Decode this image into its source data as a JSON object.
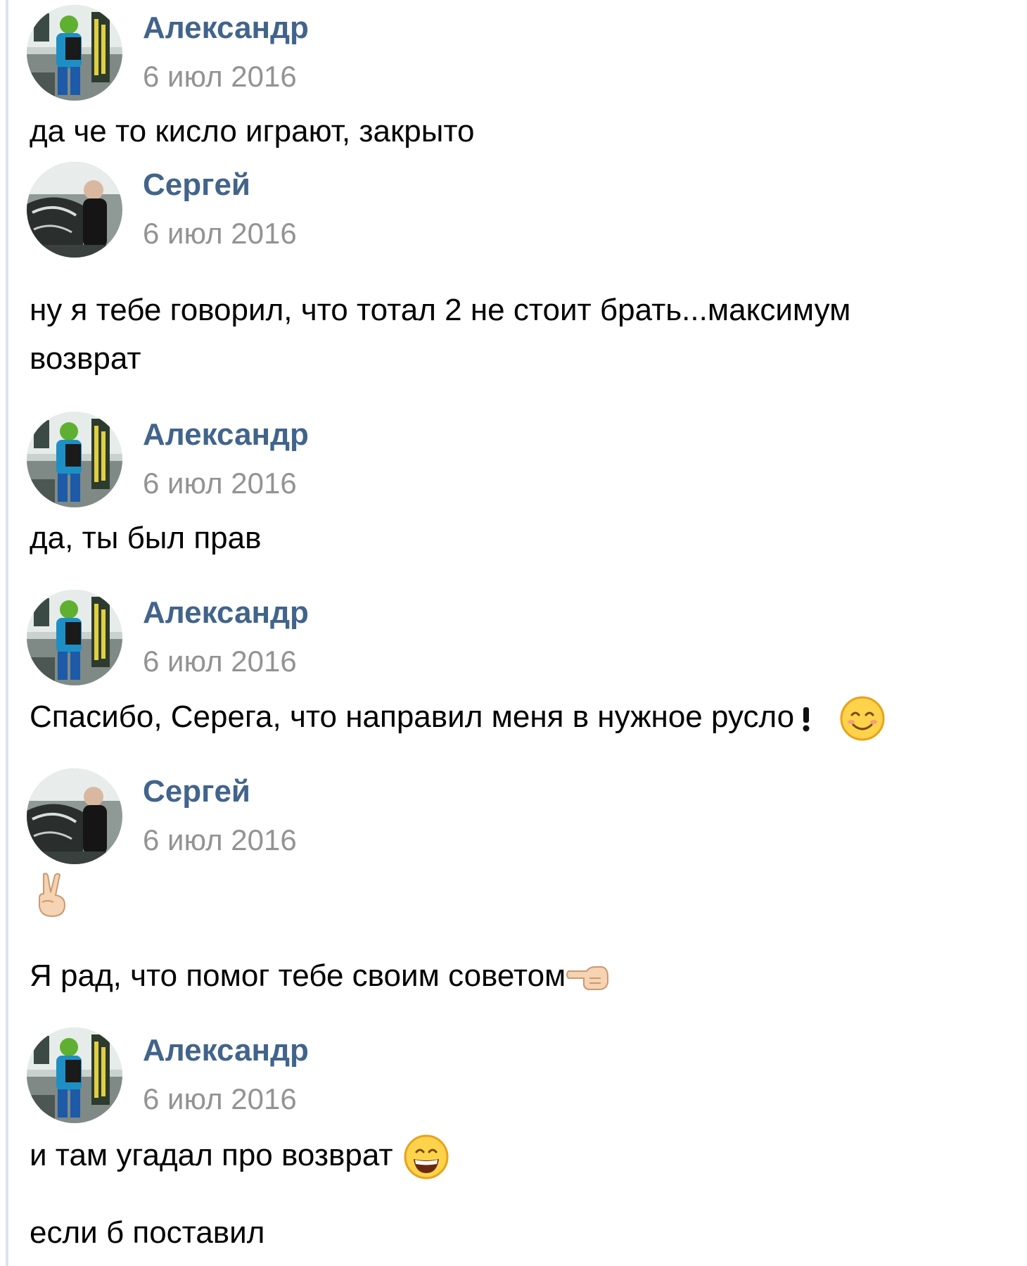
{
  "colors": {
    "author": "#42648b",
    "date": "#939393",
    "text": "#000000",
    "rule": "#dde3ec"
  },
  "messages": [
    {
      "author": "Александр",
      "date": "6 июл 2016",
      "avatar": "alexander-avatar",
      "lines": [
        "да че то кисло играют, закрыто"
      ]
    },
    {
      "author": "Сергей",
      "date": "6 июл 2016",
      "avatar": "sergey-avatar",
      "lines": [
        "ну я тебе говорил, что тотал 2 не стоит брать...максимум",
        "возврат"
      ]
    },
    {
      "author": "Александр",
      "date": "6 июл 2016",
      "avatar": "alexander-avatar",
      "lines": [
        "да, ты был прав"
      ]
    },
    {
      "author": "Александр",
      "date": "6 июл 2016",
      "avatar": "alexander-avatar",
      "lines": [
        "Спасибо, Серега, что направил меня в нужное русло"
      ],
      "emoji": [
        "exclamation-icon",
        "smiling-face-icon"
      ]
    },
    {
      "author": "Сергей",
      "date": "6 июл 2016",
      "avatar": "sergey-avatar",
      "lines": [
        "Я рад, что помог тебе своим советом"
      ],
      "emoji": [
        "victory-hand-icon",
        "pointing-left-hand-icon"
      ]
    },
    {
      "author": "Александр",
      "date": "6 июл 2016",
      "avatar": "alexander-avatar",
      "lines": [
        "и там угадал про возврат",
        "если б поставил"
      ],
      "emoji": [
        "grinning-face-icon"
      ]
    }
  ]
}
